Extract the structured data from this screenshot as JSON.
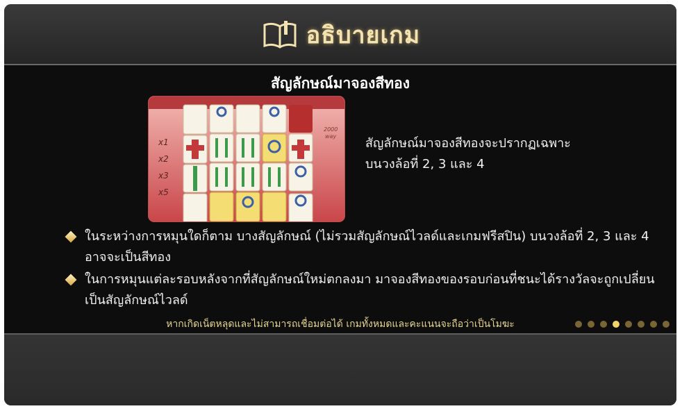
{
  "header": {
    "icon": "open-book-icon",
    "title": "อธิบายเกม"
  },
  "section": {
    "title": "สัญลักษณ์มาจองสีทอง",
    "description_line1": "สัญลักษณ์มาจองสีทองจะปรากฏเฉพาะ",
    "description_line2": "บนวงล้อที่ 2, 3 และ 4"
  },
  "preview": {
    "multipliers": [
      "x1",
      "x2",
      "x3",
      "x5"
    ],
    "side_label_1": "2000",
    "side_label_2": "way"
  },
  "rules": [
    "ในระหว่างการหมุนใดก็ตาม บางสัญลักษณ์ (ไม่รวมสัญลักษณ์ไวลด์และเกมฟรีสปิน) บนวงล้อที่ 2, 3 และ 4 อาจจะเป็นสีทอง",
    "ในการหมุนแต่ละรอบหลังจากที่สัญลักษณ์ใหม่ตกลงมา มาจองสีทองของรอบก่อนที่ชนะได้รางวัลจะถูกเปลี่ยนเป็นสัญลักษณ์ไวลด์"
  ],
  "footer_note": "หากเกิดเน็ตหลุดและไม่สามารถเชื่อมต่อได้ เกมทั้งหมดและคะแนนจะถือว่าเป็นโมฆะ",
  "pagination": {
    "total": 8,
    "active_index": 3
  },
  "colors": {
    "gold": "#f2d36b",
    "title": "#f3e3b0"
  }
}
